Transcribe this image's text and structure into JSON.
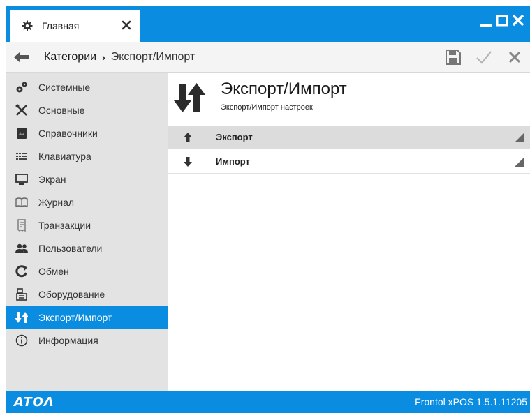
{
  "titlebar": {
    "tab_label": "Главная",
    "tab_icon": "gear-icon",
    "controls": [
      "minimize-icon",
      "maximize-icon",
      "close-icon"
    ]
  },
  "breadcrumb": {
    "parent": "Категории",
    "separator": "›",
    "current": "Экспорт/Импорт"
  },
  "toolbar": {
    "save_icon": "save-icon",
    "apply_icon": "checkmark-icon",
    "cancel_icon": "cross-icon"
  },
  "sidebar": {
    "active_index": 10,
    "items": [
      {
        "label": "Системные",
        "icon": "gears-icon"
      },
      {
        "label": "Основные",
        "icon": "tools-icon"
      },
      {
        "label": "Справочники",
        "icon": "book-icon"
      },
      {
        "label": "Клавиатура",
        "icon": "keyboard-icon"
      },
      {
        "label": "Экран",
        "icon": "monitor-icon"
      },
      {
        "label": "Журнал",
        "icon": "open-book-icon"
      },
      {
        "label": "Транзакции",
        "icon": "receipt-icon"
      },
      {
        "label": "Пользователи",
        "icon": "users-icon"
      },
      {
        "label": "Обмен",
        "icon": "sync-icon"
      },
      {
        "label": "Оборудование",
        "icon": "cash-register-icon"
      },
      {
        "label": "Экспорт/Импорт",
        "icon": "export-import-icon"
      },
      {
        "label": "Информация",
        "icon": "info-icon"
      }
    ]
  },
  "main": {
    "title": "Экспорт/Импорт",
    "subtitle": "Экспорт/Импорт настроек",
    "rows": [
      {
        "label": "Экспорт",
        "icon": "arrow-up-icon",
        "selected": true
      },
      {
        "label": "Импорт",
        "icon": "arrow-down-icon",
        "selected": false
      }
    ]
  },
  "statusbar": {
    "logo": "ATOΛ",
    "version": "Frontol xPOS 1.5.1.11205"
  },
  "colors": {
    "accent": "#0a8de0",
    "sidebar_bg": "#e3e3e3",
    "selected_row": "#dcdcdc"
  }
}
